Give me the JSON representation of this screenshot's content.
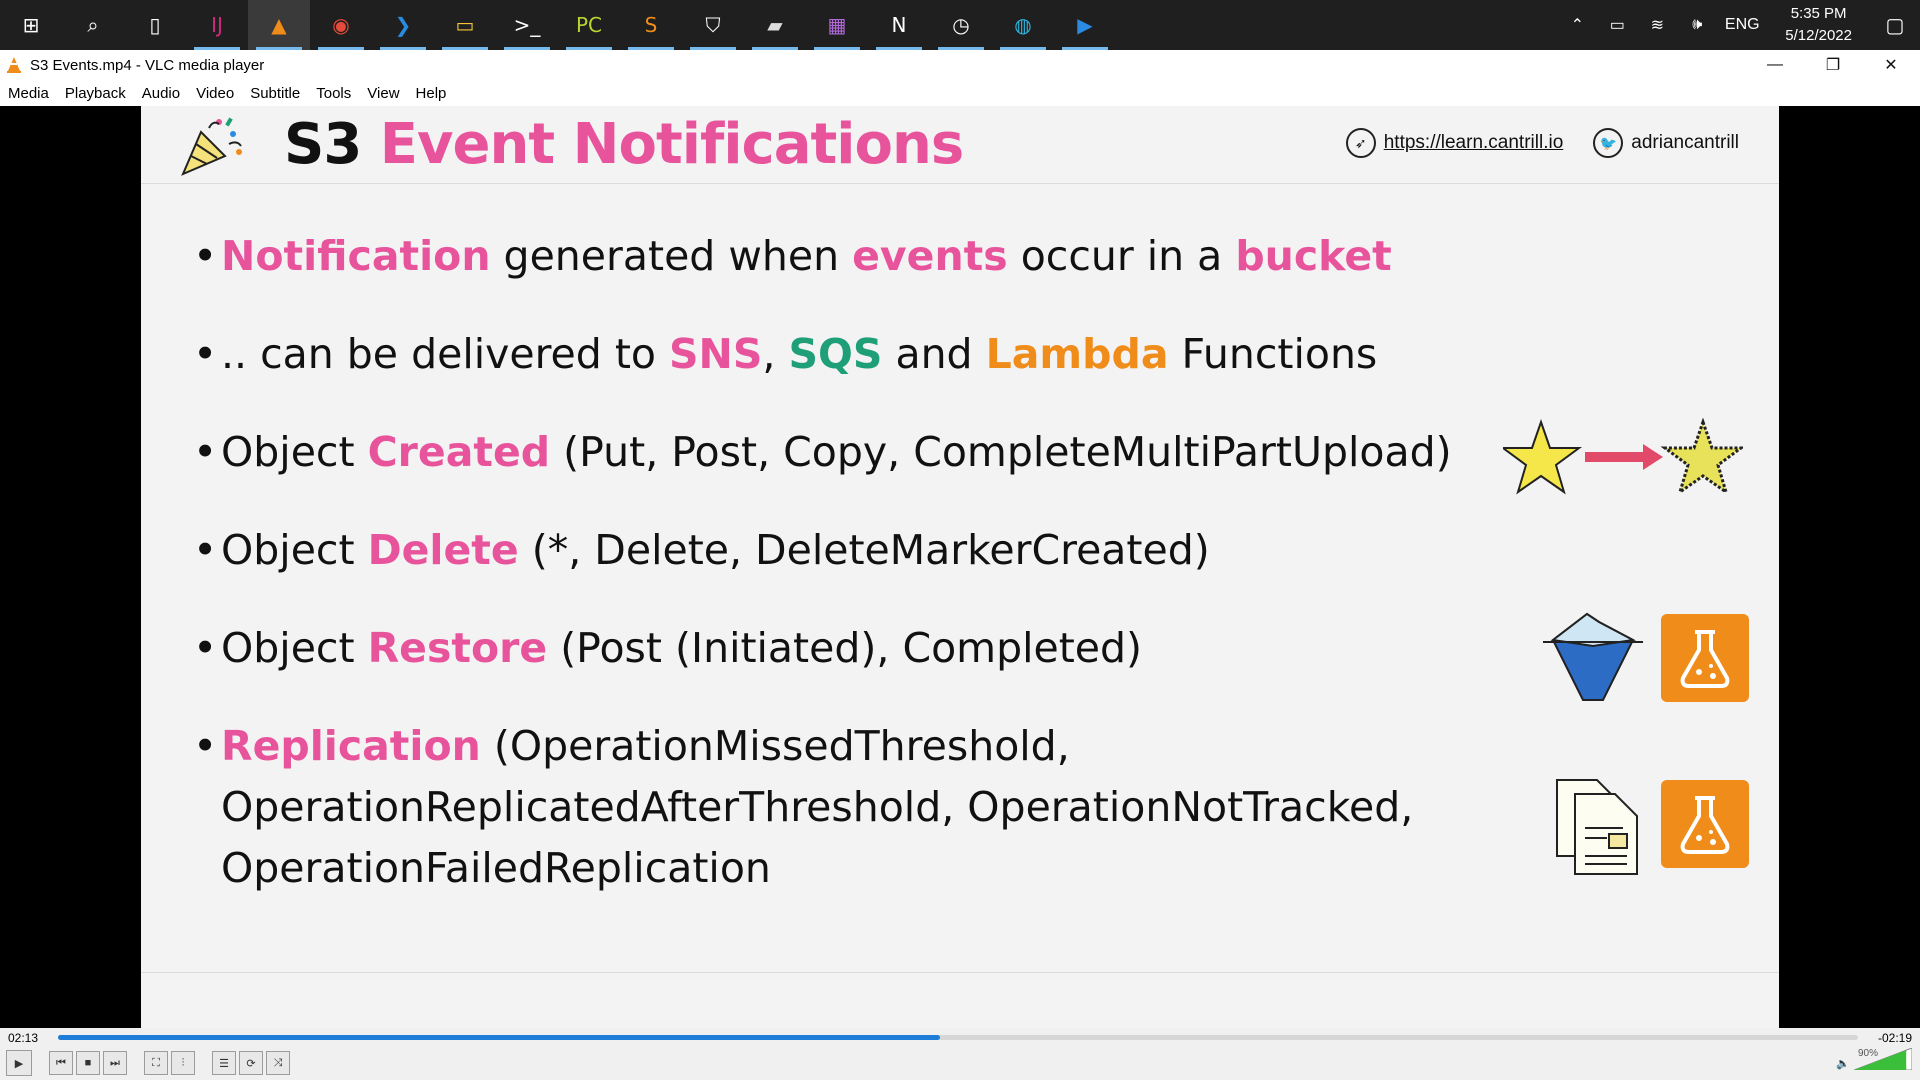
{
  "taskbar": {
    "apps": [
      {
        "name": "windows-start",
        "glyph": "⊞",
        "color": "#ffffff"
      },
      {
        "name": "search",
        "glyph": "⌕",
        "color": "#ffffff"
      },
      {
        "name": "task-view",
        "glyph": "▯",
        "color": "#ffffff"
      },
      {
        "name": "intellij",
        "glyph": "IJ",
        "color": "#cc2a7c"
      },
      {
        "name": "vlc",
        "glyph": "▲",
        "color": "#f08c1a"
      },
      {
        "name": "chrome",
        "glyph": "◉",
        "color": "#e44b3a"
      },
      {
        "name": "vscode",
        "glyph": "❯",
        "color": "#2a8be0"
      },
      {
        "name": "file-explorer",
        "glyph": "▭",
        "color": "#f3c33b"
      },
      {
        "name": "terminal",
        "glyph": ">_",
        "color": "#ffffff"
      },
      {
        "name": "pycharm",
        "glyph": "PC",
        "color": "#b8d430"
      },
      {
        "name": "sublime",
        "glyph": "S",
        "color": "#f08c1a"
      },
      {
        "name": "shield",
        "glyph": "⛉",
        "color": "#ffffff"
      },
      {
        "name": "app-hat",
        "glyph": "▰",
        "color": "#dddddd"
      },
      {
        "name": "app-grid",
        "glyph": "▦",
        "color": "#b16ad8"
      },
      {
        "name": "notion",
        "glyph": "N",
        "color": "#ffffff"
      },
      {
        "name": "clock-app",
        "glyph": "◷",
        "color": "#ffffff"
      },
      {
        "name": "edge",
        "glyph": "◍",
        "color": "#2fb6e0"
      },
      {
        "name": "media-app",
        "glyph": "▶",
        "color": "#2a8be0"
      }
    ],
    "tray": {
      "chevron": "⌃",
      "battery": "▭",
      "wifi": "≋",
      "volume": "🕪",
      "language": "ENG",
      "time": "5:35 PM",
      "date": "5/12/2022",
      "notification": "▢"
    }
  },
  "window": {
    "title": "S3 Events.mp4 - VLC media player",
    "minimize": "—",
    "maximize": "❐",
    "close": "✕"
  },
  "menu": [
    "Media",
    "Playback",
    "Audio",
    "Video",
    "Subtitle",
    "Tools",
    "View",
    "Help"
  ],
  "slide": {
    "title_part1": "S3",
    "title_part2": "Event Notifications",
    "site_link": "https://learn.cantrill.io",
    "twitter": "adriancantrill",
    "bullets": [
      {
        "segments": [
          {
            "text": "Notification",
            "style": "pink-bold"
          },
          {
            "text": " generated when ",
            "style": "plain"
          },
          {
            "text": "events",
            "style": "pink-bold"
          },
          {
            "text": " occur in a ",
            "style": "plain"
          },
          {
            "text": "bucket",
            "style": "pink-bold"
          }
        ]
      },
      {
        "segments": [
          {
            "text": ".. can be delivered to ",
            "style": "plain"
          },
          {
            "text": "SNS",
            "style": "pink-bold"
          },
          {
            "text": ", ",
            "style": "plain"
          },
          {
            "text": "SQS",
            "style": "green-bold"
          },
          {
            "text": " and ",
            "style": "plain"
          },
          {
            "text": "Lambda",
            "style": "orange-bold"
          },
          {
            "text": " Functions",
            "style": "plain"
          }
        ]
      },
      {
        "segments": [
          {
            "text": "Object ",
            "style": "plain"
          },
          {
            "text": "Created",
            "style": "pink-bold"
          },
          {
            "text": " (Put, Post, Copy, CompleteMultiPartUpload)",
            "style": "plain"
          }
        ]
      },
      {
        "segments": [
          {
            "text": "Object ",
            "style": "plain"
          },
          {
            "text": "Delete",
            "style": "pink-bold"
          },
          {
            "text": " (*, Delete, DeleteMarkerCreated)",
            "style": "plain"
          }
        ]
      },
      {
        "segments": [
          {
            "text": "Object ",
            "style": "plain"
          },
          {
            "text": "Restore",
            "style": "pink-bold"
          },
          {
            "text": " (Post (Initiated), Completed)",
            "style": "plain"
          }
        ]
      },
      {
        "lines": [
          [
            {
              "text": "Replication",
              "style": "pink-bold"
            },
            {
              "text": " (OperationMissedThreshold,",
              "style": "plain"
            }
          ],
          [
            {
              "text": "OperationReplicatedAfterThreshold, OperationNotTracked,",
              "style": "plain"
            }
          ],
          [
            {
              "text": "OperationFailedReplication",
              "style": "plain"
            }
          ]
        ]
      }
    ]
  },
  "player": {
    "elapsed": "02:13",
    "remaining": "-02:19",
    "progress": 0.49,
    "volume_label": "90%",
    "volume": 0.9
  },
  "colors": {
    "pink": "#e8549c",
    "green": "#1e9f78",
    "orange": "#f08c1a",
    "seek": "#1e7dd6"
  }
}
